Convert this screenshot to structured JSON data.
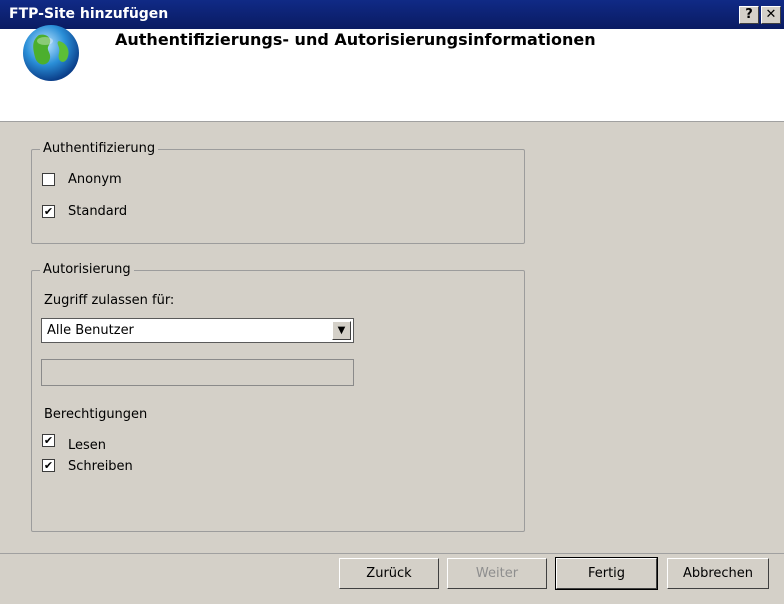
{
  "window": {
    "title": "FTP-Site hinzufügen",
    "help_label": "?",
    "close_label": "✕"
  },
  "header": {
    "title": "Authentifizierungs- und Autorisierungsinformationen",
    "icon": "globe-icon"
  },
  "authentication": {
    "legend": "Authentifizierung",
    "options": [
      {
        "label": "Anonym",
        "checked": false
      },
      {
        "label": "Standard",
        "checked": true
      }
    ]
  },
  "authorization": {
    "legend": "Autorisierung",
    "access_label": "Zugriff zulassen für:",
    "access_value": "Alle Benutzer",
    "user_field_value": "",
    "permissions_label": "Berechtigungen",
    "permissions": [
      {
        "label": "Lesen",
        "checked": true
      },
      {
        "label": "Schreiben",
        "checked": true
      }
    ]
  },
  "footer": {
    "back_label": "Zurück",
    "next_label": "Weiter",
    "finish_label": "Fertig",
    "cancel_label": "Abbrechen"
  },
  "colors": {
    "titlebar": "#0b1f6e",
    "dialog_bg": "#d4d0c8"
  }
}
